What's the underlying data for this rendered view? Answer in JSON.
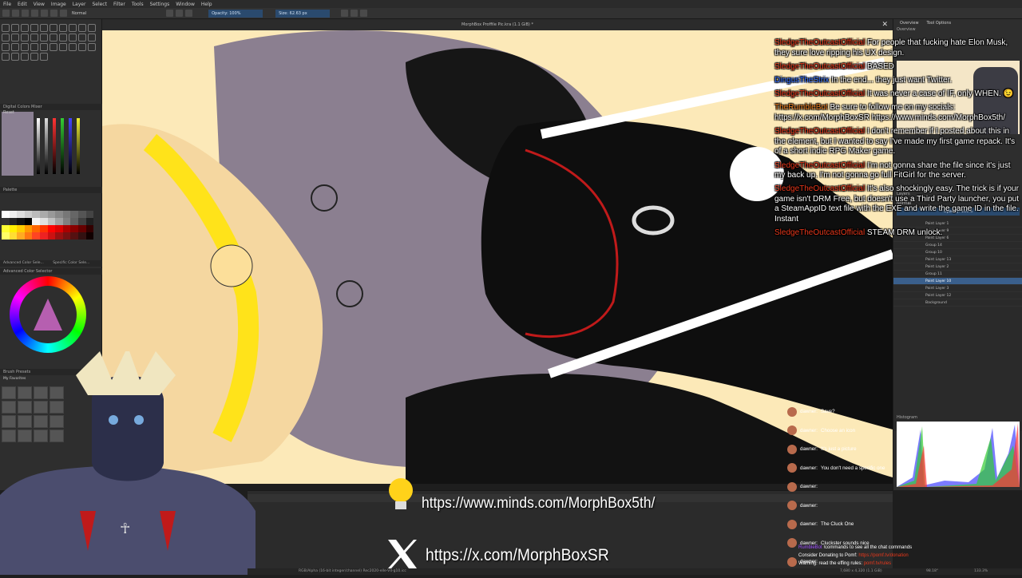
{
  "app": {
    "menu": [
      "File",
      "Edit",
      "View",
      "Image",
      "Layer",
      "Select",
      "Filter",
      "Tools",
      "Settings",
      "Window",
      "Help"
    ],
    "toolbar": {
      "blend_mode": "Normal",
      "opacity": "Opacity: 100%",
      "size": "Size: 62.63 px"
    },
    "document_title": "MorphBox Proffile Pic.kra (1.1 GiB) *",
    "left_panels": {
      "mixer_title": "Digital Colors Mixer",
      "reset": "Reset",
      "palette_title": "Palette",
      "adv_color_tab1": "Advanced Color Sele...",
      "adv_color_tab2": "Specific Color Sele...",
      "adv_color_title": "Advanced Color Selector",
      "brush_presets_title": "Brush Presets",
      "brush_presets_tag": "My Favorites"
    },
    "right_panels": {
      "tab_overview": "Overview",
      "tab_tool_options": "Tool Options",
      "overview_title": "Overview",
      "zoom": "133.3%",
      "layers_title": "Layers",
      "layers_blend": "Normal",
      "layers_opacity": "Opacity: 100%",
      "histogram_title": "Histogram",
      "layers": [
        {
          "name": "Paint Layer 1",
          "selected": false
        },
        {
          "name": "Paint Layer 9",
          "selected": false
        },
        {
          "name": "Paint Layer 6",
          "selected": false
        },
        {
          "name": "Group 14",
          "selected": false
        },
        {
          "name": "Group 10",
          "selected": false
        },
        {
          "name": "Paint Layer 13",
          "selected": false
        },
        {
          "name": "Paint Layer 2",
          "selected": false
        },
        {
          "name": "Group 11",
          "selected": false
        },
        {
          "name": "Paint Layer 10",
          "selected": true
        },
        {
          "name": "Paint Layer 3",
          "selected": false
        },
        {
          "name": "Paint Layer 12",
          "selected": false
        },
        {
          "name": "Background",
          "selected": false
        }
      ]
    },
    "status": {
      "left": "RGB/Alpha (16-bit integer/channel)  Rec2020-elle-V4-g10.icc",
      "right": "7,680 x 4,320 (1.1 GiB)",
      "zoom": "133.3%",
      "angle": "98.18°"
    }
  },
  "chat": [
    {
      "user": "SledgeTheOutcastOfficial",
      "color": "#e8381b",
      "text": "For people that fucking hate Elon Musk, they sure love ripping his UX design."
    },
    {
      "user": "SledgeTheOutcastOfficial",
      "color": "#e8381b",
      "text": "BASED"
    },
    {
      "user": "DingusTheStrix",
      "color": "#2e6bff",
      "text": "In the end... they just want Twitter."
    },
    {
      "user": "SledgeTheOutcastOfficial",
      "color": "#e8381b",
      "text": "It was never a case of IF, only WHEN. 😉"
    },
    {
      "user": "TheRumbleBot",
      "color": "#e87a1b",
      "text": "Be sure to follow me on my socials: https://x.com/MorphBoxSR https://www.minds.com/MorphBox5th/"
    },
    {
      "user": "SledgeTheOutcastOfficial",
      "color": "#e8381b",
      "text": "I don't remember if I posted about this in the element, but I wanted to say I've made my first game repack. It's of a short indie RPG Maker game."
    },
    {
      "user": "SledgeTheOutcastOfficial",
      "color": "#e8381b",
      "text": "I'm not gonna share the file since it's just my back up. I'm not gonna go full FitGirl for the server."
    },
    {
      "user": "SledgeTheOutcastOfficial",
      "color": "#e8381b",
      "text": "It's also shockingly easy. The trick is if your game isn't DRM Free, but doesn't use a Third Party launcher, you put a SteamAppID text file with the EXE and write the game ID in the file. Instant"
    },
    {
      "user": "SledgeTheOutcastOfficial",
      "color": "#e8381b",
      "text": "STEAM DRM unlock."
    }
  ],
  "chat2": [
    {
      "user": "dawner:",
      "text": "Save?"
    },
    {
      "user": "dawner:",
      "text": "Choose an icon"
    },
    {
      "user": "dawner:",
      "text": "It's just a picture"
    },
    {
      "user": "dawner:",
      "text": "You don't need a specific one"
    },
    {
      "user": "dawner:",
      "text": ""
    },
    {
      "user": "dawner:",
      "text": ""
    },
    {
      "user": "dawner:",
      "text": "The Cluck One"
    },
    {
      "user": "dawner:",
      "text": "Cluckster sounds nice"
    },
    {
      "user": "dawner:",
      "text": ""
    }
  ],
  "bot_lines": {
    "line1_user": "RumbleBot",
    "line1_text": "!commands to see all the chat commands",
    "line2_text": "Consider Donating to Pomf:",
    "line2_link": "https://pomf.tv/donation",
    "line3_text": "Warning: read the effing rules:",
    "line3_link": "pomf.tv/rules"
  },
  "overlay_links": {
    "minds": "https://www.minds.com/MorphBox5th/",
    "x": "https://x.com/MorphBoxSR"
  },
  "colors": {
    "canvas_bg": "#fce9b8",
    "accent_selection": "#3a5f8c",
    "chat_red": "#e8381b",
    "chat_blue": "#2e6bff",
    "chat_orange": "#e87a1b"
  }
}
